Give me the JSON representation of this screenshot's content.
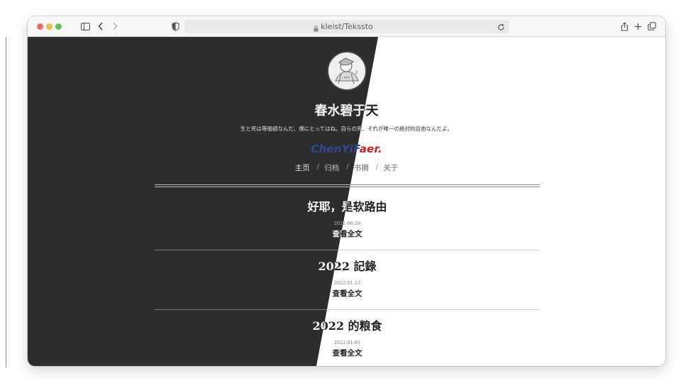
{
  "browser": {
    "url": "kleist/Tekssto"
  },
  "site": {
    "title": "春水碧于天",
    "description": "生と死は等価値なんだ、僕にとってはね。自らの死、それが唯一の絶対的自由なんだよ。",
    "logo_part1": "ChenYiF",
    "logo_part2": "aer."
  },
  "nav": {
    "home": "主页",
    "archive": "归档",
    "excerpts": "书摘",
    "about": "关于",
    "separator": "/"
  },
  "posts": [
    {
      "title": "好耶，是软路由",
      "date": "2022-06-28",
      "more": "查看全文"
    },
    {
      "title": "2022 記錄",
      "date": "2022-01-13",
      "more": "查看全文"
    },
    {
      "title": "2022 的粮食",
      "date": "2022-01-01",
      "more": "查看全文"
    }
  ],
  "colors": {
    "dark_bg": "#2d2d2d",
    "light_bg": "#ffffff",
    "logo_blue": "#2a4a9a",
    "logo_red": "#c81e1e"
  }
}
